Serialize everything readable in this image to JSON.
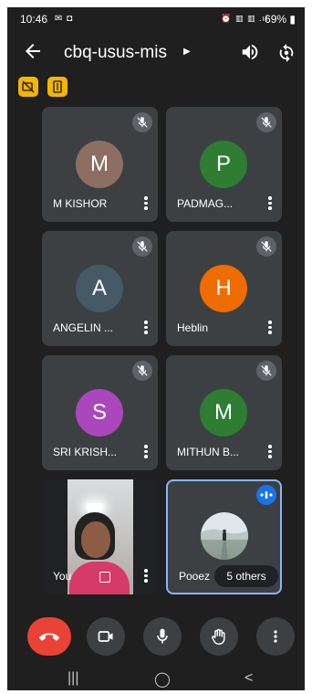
{
  "status_bar": {
    "time": "10:46",
    "battery": "69%"
  },
  "meeting": {
    "title": "cbq-usus-mis"
  },
  "participants": [
    {
      "initial": "M",
      "name": "M KISHOR",
      "avatar_color": "#8d6e63",
      "muted": true
    },
    {
      "initial": "P",
      "name": "PADMAG...",
      "avatar_color": "#2e7d32",
      "muted": true
    },
    {
      "initial": "A",
      "name": "ANGELIN ...",
      "avatar_color": "#455a64",
      "muted": true
    },
    {
      "initial": "H",
      "name": "Heblin",
      "avatar_color": "#ef6c00",
      "muted": true
    },
    {
      "initial": "S",
      "name": "SRI KRISH...",
      "avatar_color": "#ab47bc",
      "muted": true
    },
    {
      "initial": "M",
      "name": "MITHUN B...",
      "avatar_color": "#2e7d32",
      "muted": true
    }
  ],
  "self_tile": {
    "name": "You"
  },
  "others_tile": {
    "name": "Pooez",
    "others_label": "5 others"
  },
  "colors": {
    "background": "#1f1f1f",
    "tile": "#3c4043",
    "end_call": "#ea4335",
    "badge": "#f2b600",
    "speaking_border": "#8ab4f8"
  },
  "icons": {
    "back": "arrow-left-icon",
    "speaker": "speaker-icon",
    "flip_camera": "flip-camera-icon",
    "end_call": "phone-hangup-icon",
    "camera": "video-camera-icon",
    "mic": "microphone-icon",
    "raise_hand": "hand-icon",
    "more": "more-vert-icon"
  }
}
